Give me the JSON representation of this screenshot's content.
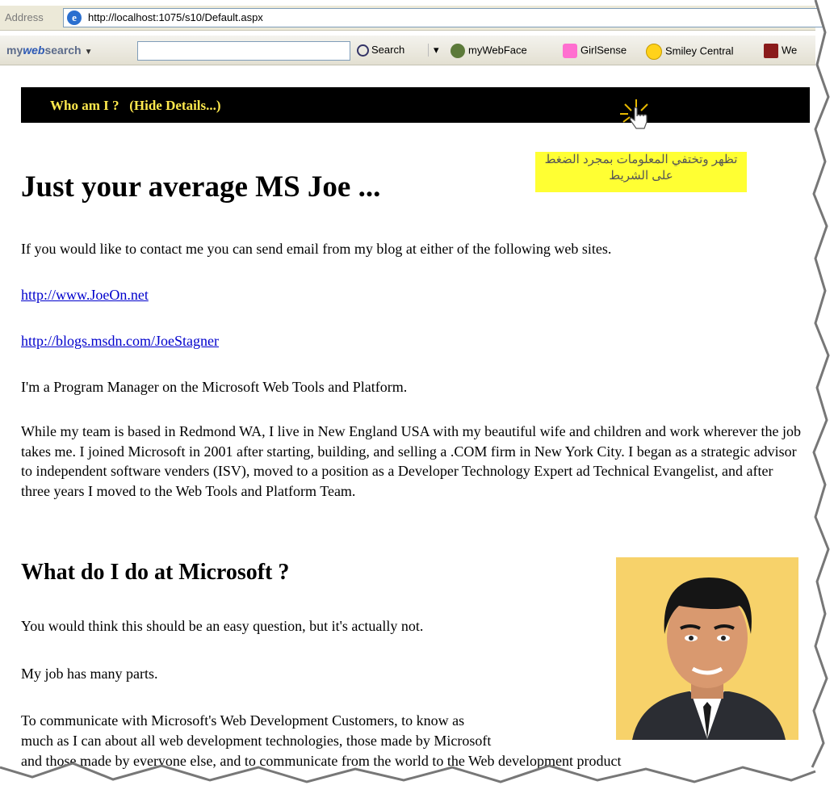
{
  "address_bar": {
    "label": "Address",
    "url": "http://localhost:1075/s10/Default.aspx"
  },
  "toolbar": {
    "brand_prefix": "my",
    "brand_web": "web",
    "brand_suffix": "search",
    "search_label": "Search",
    "items": [
      "myWebFace",
      "GirlSense",
      "Smiley Central",
      "We"
    ]
  },
  "banner": {
    "text": "Who am I ?   (Hide Details...)"
  },
  "annotation": {
    "text": "تظهر وتختفي المعلومات بمجرد الضغط على الشريط"
  },
  "page": {
    "title": "Just your average MS Joe ...",
    "intro": " If you would like to contact me you can send email from my blog at either of the following web sites.",
    "link1": "http://www.JoeOn.net",
    "link2": "http://blogs.msdn.com/JoeStagner",
    "role": "I'm a Program Manager on the Microsoft Web Tools and Platform.",
    "bio": "While my team is based in Redmond WA, I live in New England USA with my beautiful wife and children and work wherever the job takes me. I joined Microsoft in 2001 after starting, building, and selling a .COM firm in New York City. I began as a strategic advisor to independent software venders (ISV), moved to a position as a Developer Technology Expert ad Technical Evangelist, and after three years I moved to the Web Tools and Platform Team.",
    "section_title": "What do I do at Microsoft ?",
    "q": "You would think this should be an easy question, but it's actually not.",
    "parts": "My job has many parts.",
    "comm1": "To communicate with Microsoft's Web Development Customers, to know as",
    "comm2": "much as I can about all web development technologies, those made by Microsoft",
    "comm3": "and those made by everyone else, and to communicate from the world to the Web development product"
  }
}
